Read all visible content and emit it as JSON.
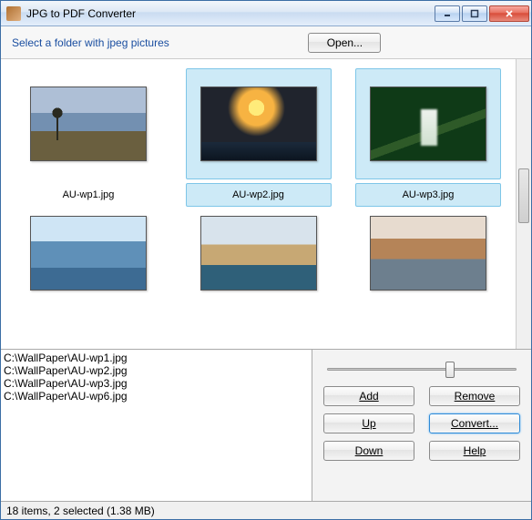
{
  "window": {
    "title": "JPG to PDF Converter"
  },
  "toolbar": {
    "prompt": "Select a folder with jpeg pictures",
    "open": "Open..."
  },
  "thumbs": [
    {
      "name": "AU-wp1.jpg",
      "selected": false
    },
    {
      "name": "AU-wp2.jpg",
      "selected": true
    },
    {
      "name": "AU-wp3.jpg",
      "selected": true
    },
    {
      "name": "",
      "selected": false
    },
    {
      "name": "",
      "selected": false
    },
    {
      "name": "",
      "selected": false
    }
  ],
  "list": [
    "C:\\WallPaper\\AU-wp1.jpg",
    "C:\\WallPaper\\AU-wp2.jpg",
    "C:\\WallPaper\\AU-wp3.jpg",
    "C:\\WallPaper\\AU-wp6.jpg"
  ],
  "buttons": {
    "add": "Add",
    "remove": "Remove",
    "up": "Up",
    "convert": "Convert...",
    "down": "Down",
    "help": "Help"
  },
  "status": "18 items, 2 selected (1.38 MB)"
}
